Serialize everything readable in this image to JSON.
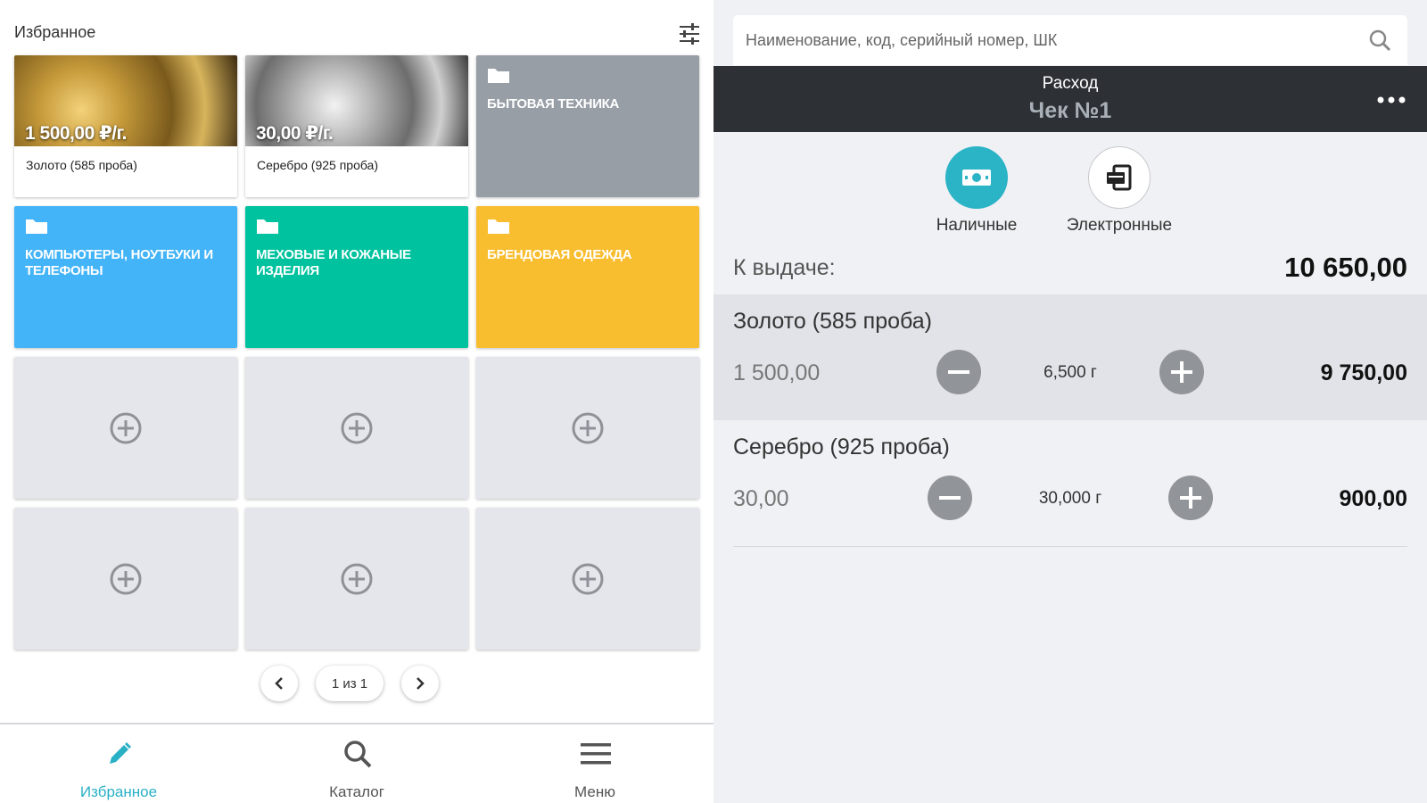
{
  "favorites": {
    "title": "Избранное",
    "products": [
      {
        "price": "1 500,00 ₽/г.",
        "name": "Золото (585 проба)"
      },
      {
        "price": "30,00 ₽/г.",
        "name": "Серебро (925 проба)"
      }
    ],
    "folders": [
      {
        "title": "БЫТОВАЯ ТЕХНИКА",
        "color": "#979ea6"
      },
      {
        "title": "КОМПЬЮТЕРЫ, НОУТБУКИ И ТЕЛЕФОНЫ",
        "color": "#44b4f8"
      },
      {
        "title": "МЕХОВЫЕ И КОЖАНЫЕ ИЗДЕЛИЯ",
        "color": "#00c29e"
      },
      {
        "title": "БРЕНДОВАЯ ОДЕЖДА",
        "color": "#f8be30"
      }
    ],
    "pager": {
      "label": "1 из 1"
    }
  },
  "bottom_nav": {
    "items": [
      {
        "label": "Избранное",
        "icon": "pencil-icon",
        "active": true
      },
      {
        "label": "Каталог",
        "icon": "search-icon",
        "active": false
      },
      {
        "label": "Меню",
        "icon": "menu-icon",
        "active": false
      }
    ]
  },
  "search": {
    "placeholder": "Наименование, код, серийный номер, ШК"
  },
  "document": {
    "type": "Расход",
    "number": "Чек №1"
  },
  "payment": {
    "cash_label": "Наличные",
    "electronic_label": "Электронные"
  },
  "total": {
    "label": "К выдаче:",
    "value": "10 650,00"
  },
  "lines": [
    {
      "name": "Золото (585 проба)",
      "price": "1 500,00",
      "qty": "6,500 г",
      "sum": "9 750,00"
    },
    {
      "name": "Серебро (925 проба)",
      "price": "30,00",
      "qty": "30,000 г",
      "sum": "900,00"
    }
  ],
  "colors": {
    "accent": "#2ab0c5",
    "header_bar": "#2d3034",
    "qty_button": "#919499"
  }
}
